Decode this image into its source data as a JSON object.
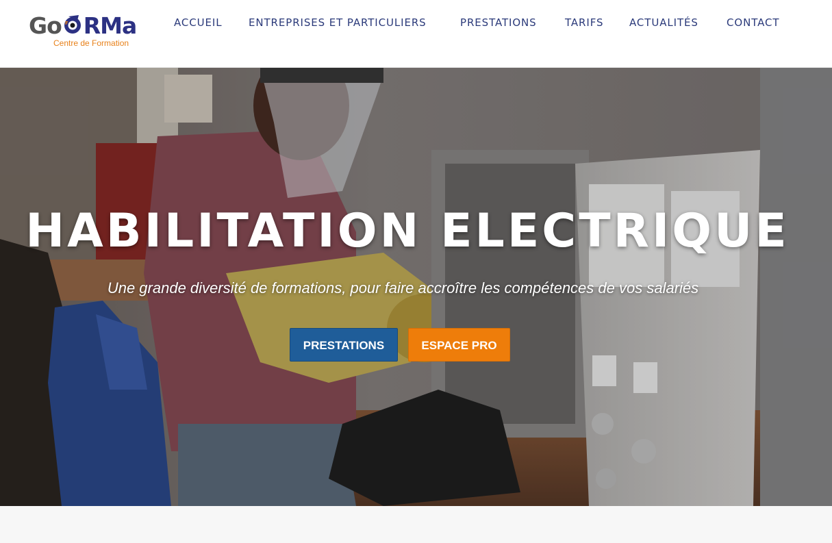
{
  "brand": {
    "logo_go": "Go",
    "logo_rest": "RMa",
    "tagline": "Centre de Formation",
    "colors": {
      "grey": "#555555",
      "navy": "#2c3183",
      "orange": "#e8811a"
    }
  },
  "nav": {
    "items": [
      {
        "label": "ACCUEIL"
      },
      {
        "label": "ENTREPRISES ET PARTICULIERS"
      },
      {
        "label": "PRESTATIONS"
      },
      {
        "label": "TARIFS"
      },
      {
        "label": "ACTUALITÉS"
      },
      {
        "label": "CONTACT"
      }
    ],
    "color": "#2b3a7a"
  },
  "hero": {
    "title": "HABILITATION ELECTRIQUE",
    "subtitle": "Une grande diversité de formations, pour faire accroître les compétences de vos salariés",
    "buttons": {
      "primary": {
        "label": "PRESTATIONS",
        "color": "#1f5d99"
      },
      "secondary": {
        "label": "ESPACE PRO",
        "color": "#ee7d0a"
      }
    },
    "image": "electrician-training-photo"
  }
}
